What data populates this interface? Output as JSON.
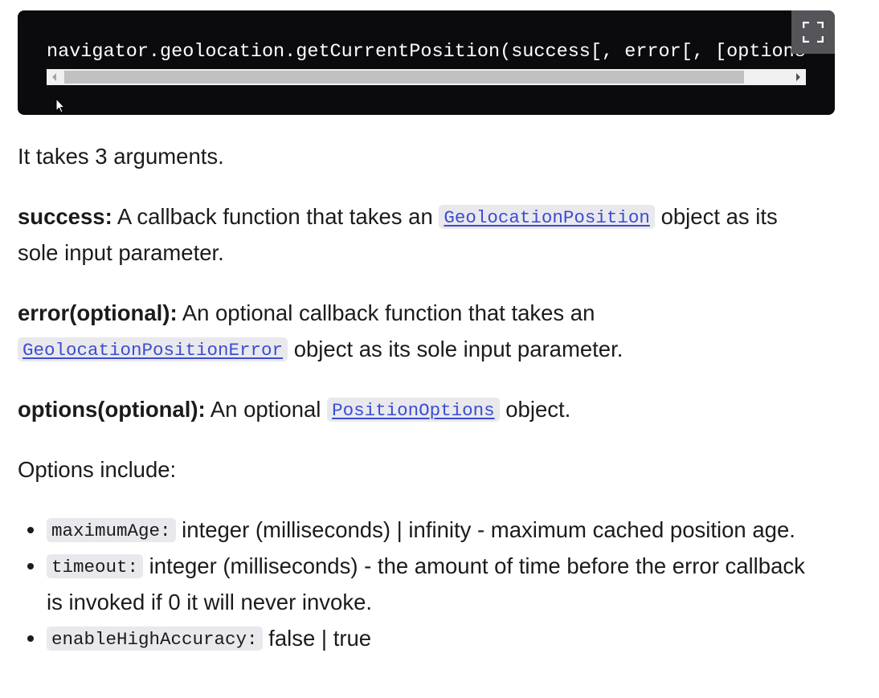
{
  "code_block": {
    "code": "navigator.geolocation.getCurrentPosition(success[, error[, [options]]])",
    "expand_icon": "fullscreen-icon"
  },
  "intro": "It takes 3 arguments.",
  "args": {
    "success": {
      "term": "success:",
      "text_before": " A callback function that takes an ",
      "link": "GeolocationPosition",
      "text_after": " object as its sole input parameter."
    },
    "error": {
      "term": "error(optional):",
      "text_before": " An optional callback function that takes an ",
      "link": "GeolocationPositionError",
      "text_after": " object as its sole input parameter."
    },
    "options": {
      "term": "options(optional):",
      "text_before": " An optional ",
      "link": "PositionOptions",
      "text_after": " object."
    }
  },
  "options_heading": "Options include:",
  "options_list": [
    {
      "code": "maximumAge:",
      "text": " integer (milliseconds) | infinity - maximum cached position age."
    },
    {
      "code": "timeout:",
      "text": " integer (milliseconds) - the amount of time before the error callback is invoked if 0 it will never invoke."
    },
    {
      "code": "enableHighAccuracy:",
      "text": " false | true"
    }
  ],
  "colors": {
    "code_bg": "#0b0b0d",
    "link": "#3b4dd0",
    "inline_code_bg": "#e9e9ed",
    "expand_btn_bg": "#545459"
  }
}
